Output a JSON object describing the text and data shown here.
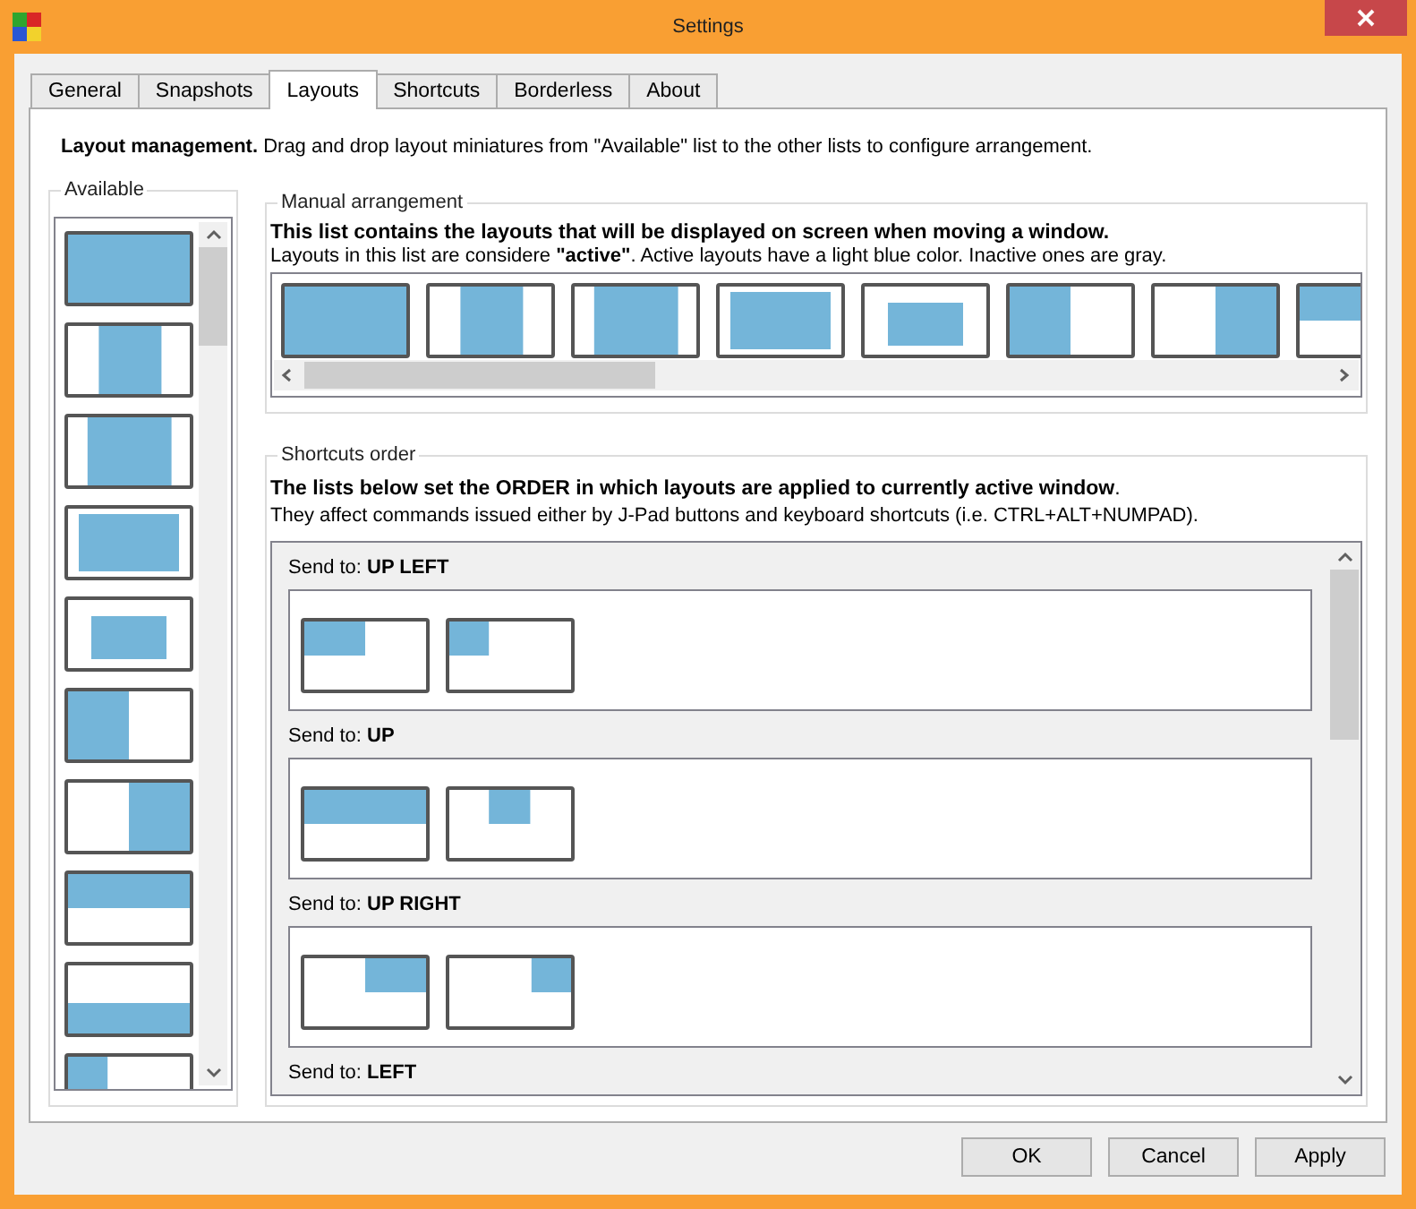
{
  "window": {
    "title": "Settings"
  },
  "tabs": [
    {
      "label": "General",
      "selected": false
    },
    {
      "label": "Snapshots",
      "selected": false
    },
    {
      "label": "Layouts",
      "selected": true
    },
    {
      "label": "Shortcuts",
      "selected": false
    },
    {
      "label": "Borderless",
      "selected": false
    },
    {
      "label": "About",
      "selected": false
    }
  ],
  "intro": "**Layout management.** Drag and drop layout miniatures from \"Available\" list to the other lists to configure arrangement.",
  "available": {
    "title": "Available",
    "layouts": [
      {
        "kind": "full"
      },
      {
        "kind": "center-half"
      },
      {
        "kind": "center-wide"
      },
      {
        "kind": "inset-large"
      },
      {
        "kind": "inset-small"
      },
      {
        "kind": "left-half"
      },
      {
        "kind": "right-half"
      },
      {
        "kind": "top-half"
      },
      {
        "kind": "bottom-half"
      },
      {
        "kind": "left-third"
      }
    ]
  },
  "manual": {
    "title": "Manual arrangement",
    "heading": "This list contains the layouts that will be displayed on screen when moving a window.",
    "note": "Layouts in this list are considere **\"active\"**. Active layouts have a light blue color. Inactive ones are gray.",
    "layouts": [
      {
        "kind": "full"
      },
      {
        "kind": "center-half"
      },
      {
        "kind": "center-wide"
      },
      {
        "kind": "inset-large"
      },
      {
        "kind": "inset-small"
      },
      {
        "kind": "left-half"
      },
      {
        "kind": "right-half"
      },
      {
        "kind": "top-half"
      }
    ]
  },
  "shortcuts": {
    "title": "Shortcuts order",
    "heading": "**The lists below set the ORDER in which layouts are applied to currently active window**.",
    "note": "They affect commands issued either by J-Pad buttons and keyboard shortcuts (i.e. CTRL+ALT+NUMPAD).",
    "groups": [
      {
        "label": "Send to: **UP LEFT**",
        "layouts": [
          {
            "kind": "top-left-quarter"
          },
          {
            "kind": "top-left-small"
          }
        ]
      },
      {
        "label": "Send to: **UP**",
        "layouts": [
          {
            "kind": "top-half"
          },
          {
            "kind": "top-center-small"
          }
        ]
      },
      {
        "label": "Send to: **UP RIGHT**",
        "layouts": [
          {
            "kind": "top-right-quarter"
          },
          {
            "kind": "top-right-small"
          }
        ]
      },
      {
        "label": "Send to: **LEFT**"
      }
    ]
  },
  "buttons": [
    "OK",
    "Cancel",
    "Apply"
  ]
}
